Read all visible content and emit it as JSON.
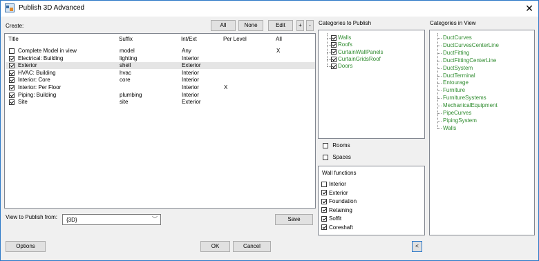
{
  "window": {
    "title": "Publish 3D Advanced",
    "close_glyph": "✕"
  },
  "create": {
    "label": "Create:",
    "buttons": {
      "all": "All",
      "none": "None",
      "edit": "Edit",
      "plus": "+",
      "minus": "-"
    },
    "columns": [
      "Title",
      "Suffix",
      "Int/Ext",
      "Per Level",
      "All"
    ],
    "rows": [
      {
        "checked": false,
        "title": "Complete Model in view",
        "suffix": "model",
        "intext": "Any",
        "perlevel": "",
        "all": "X",
        "selected": false
      },
      {
        "checked": true,
        "title": "Electrical: Building",
        "suffix": "lighting",
        "intext": "Interior",
        "perlevel": "",
        "all": "",
        "selected": false
      },
      {
        "checked": true,
        "title": "Exterior",
        "suffix": "shell",
        "intext": "Exterior",
        "perlevel": "",
        "all": "",
        "selected": true
      },
      {
        "checked": true,
        "title": "HVAC: Building",
        "suffix": "hvac",
        "intext": "Interior",
        "perlevel": "",
        "all": "",
        "selected": false
      },
      {
        "checked": true,
        "title": "Interior: Core",
        "suffix": "core",
        "intext": "Interior",
        "perlevel": "",
        "all": "",
        "selected": false
      },
      {
        "checked": true,
        "title": "Interior: Per Floor",
        "suffix": "",
        "intext": "Interior",
        "perlevel": "X",
        "all": "",
        "selected": false
      },
      {
        "checked": true,
        "title": "Piping: Building",
        "suffix": "plumbing",
        "intext": "Interior",
        "perlevel": "",
        "all": "",
        "selected": false
      },
      {
        "checked": true,
        "title": "Site",
        "suffix": "site",
        "intext": "Exterior",
        "perlevel": "",
        "all": "",
        "selected": false
      }
    ]
  },
  "view_publish": {
    "label": "View to Publish from:",
    "value": "{3D}",
    "save": "Save"
  },
  "categories_to_publish": {
    "label": "Categories to Publish",
    "items": [
      {
        "label": "Walls",
        "checked": true
      },
      {
        "label": "Roofs",
        "checked": true
      },
      {
        "label": "CurtainWallPanels",
        "checked": true
      },
      {
        "label": "CurtainGridsRoof",
        "checked": true
      },
      {
        "label": "Doors",
        "checked": true
      }
    ]
  },
  "rooms": {
    "label": "Rooms",
    "checked": false
  },
  "spaces": {
    "label": "Spaces",
    "checked": false
  },
  "wall_functions": {
    "label": "Wall functions",
    "items": [
      {
        "label": "Interior",
        "checked": false
      },
      {
        "label": "Exterior",
        "checked": true
      },
      {
        "label": "Foundation",
        "checked": true
      },
      {
        "label": "Retaining",
        "checked": true
      },
      {
        "label": "Soffit",
        "checked": true
      },
      {
        "label": "Coreshaft",
        "checked": true
      }
    ]
  },
  "categories_in_view": {
    "label": "Categories in View",
    "items": [
      "DuctCurves",
      "DuctCurvesCenterLine",
      "DuctFitting",
      "DuctFittingCenterLine",
      "DuctSystem",
      "DuctTerminal",
      "Entourage",
      "Furniture",
      "FurnitureSystems",
      "MechanicalEquipment",
      "PipeCurves",
      "PipingSystem",
      "Walls"
    ]
  },
  "footer": {
    "options": "Options",
    "ok": "OK",
    "cancel": "Cancel",
    "collapse": "<"
  },
  "colors": {
    "category_text": "#2e8b2e",
    "accent": "#2b78c7"
  }
}
